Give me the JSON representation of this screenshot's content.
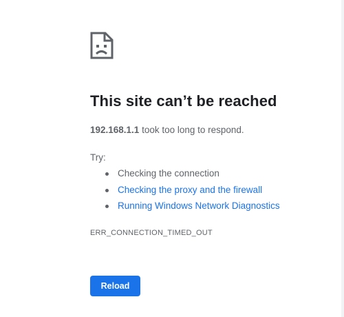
{
  "error": {
    "icon": "sad-document-icon",
    "title": "This site can’t be reached",
    "host": "192.168.1.1",
    "description_suffix": " took too long to respond.",
    "try_label": "Try:",
    "suggestions": [
      {
        "text": "Checking the connection",
        "link": false
      },
      {
        "text": "Checking the proxy and the firewall",
        "link": true
      },
      {
        "text": "Running Windows Network Diagnostics",
        "link": true
      }
    ],
    "code": "ERR_CONNECTION_TIMED_OUT",
    "reload_label": "Reload"
  },
  "colors": {
    "accent": "#1a73e8",
    "title": "#202124",
    "body_text": "#5f6368"
  }
}
